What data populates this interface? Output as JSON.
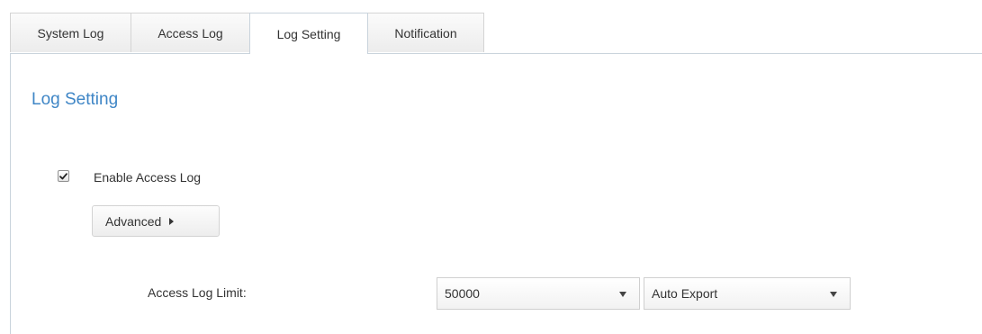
{
  "tabs": [
    {
      "label": "System Log",
      "active": false
    },
    {
      "label": "Access Log",
      "active": false
    },
    {
      "label": "Log Setting",
      "active": true
    },
    {
      "label": "Notification",
      "active": false
    }
  ],
  "section": {
    "title": "Log Setting"
  },
  "enable_access_log": {
    "label": "Enable Access Log",
    "checked": true
  },
  "advanced_button": {
    "label": "Advanced",
    "icon": "triangle-right-icon"
  },
  "access_log_limit": {
    "label": "Access Log Limit:",
    "value": "50000",
    "action_value": "Auto Export",
    "icon": "dropdown-caret-icon"
  },
  "colors": {
    "accent": "#3f86c6",
    "border": "#c9d3dc"
  }
}
